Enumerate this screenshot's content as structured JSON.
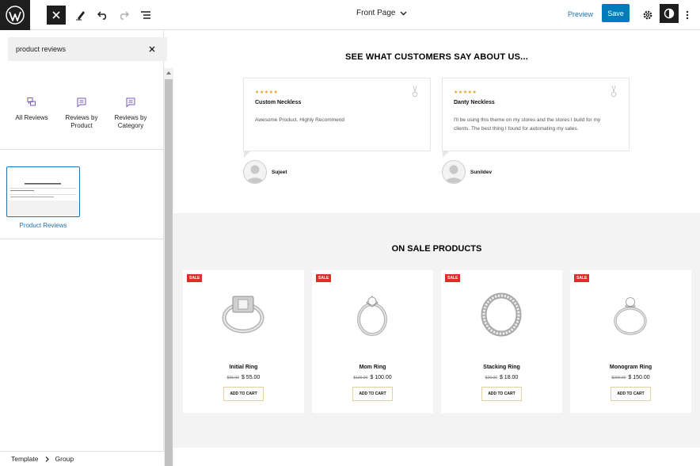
{
  "topbar": {
    "page_title": "Front Page",
    "preview_label": "Preview",
    "save_label": "Save",
    "icons": [
      "wordpress-logo",
      "close-icon",
      "pencil-icon",
      "undo-icon",
      "redo-icon",
      "list-view-icon",
      "chevron-down-icon",
      "gear-icon",
      "styles-icon",
      "more-vertical-icon"
    ]
  },
  "sidebar": {
    "search_value": "product reviews",
    "block_items": [
      {
        "label": "All Reviews",
        "icon": "reviews-icon"
      },
      {
        "label": "Reviews by Product",
        "icon": "comment-content-icon"
      },
      {
        "label": "Reviews by Category",
        "icon": "comment-content-icon"
      }
    ],
    "pattern_label": "Product Reviews"
  },
  "breadcrumb": {
    "items": [
      "Template",
      "Group"
    ]
  },
  "canvas": {
    "reviews_heading": "SEE WHAT CUSTOMERS SAY ABOUT US...",
    "reviews": [
      {
        "stars": "★★★★★",
        "title": "Custom Neckless",
        "text": "Awesome Product. Highly Recommend",
        "reviewer": "Sujeet"
      },
      {
        "stars": "★★★★★",
        "title": "Danty Neckless",
        "text": "I'll be using this theme on my stores and the stores I build for my clients. The best thing I found for automating my sales.",
        "reviewer": "Sunildev"
      }
    ],
    "sale_heading": "ON SALE PRODUCTS",
    "sale_badge": "SALE",
    "cart_label": "ADD TO CART",
    "products": [
      {
        "name": "Initial Ring",
        "old_price": "$65.00",
        "price": "$ 55.00"
      },
      {
        "name": "Mom Ring",
        "old_price": "$120.00",
        "price": "$ 100.00"
      },
      {
        "name": "Stacking Ring",
        "old_price": "$20.00",
        "price": "$ 18.00"
      },
      {
        "name": "Monogram Ring",
        "old_price": "$200.00",
        "price": "$ 150.00"
      }
    ]
  },
  "colors": {
    "accent": "#007cba",
    "link": "#2271b1",
    "star": "#e0a421",
    "sale": "#e02b27"
  }
}
